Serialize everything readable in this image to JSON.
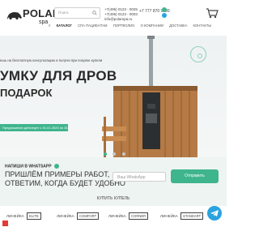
{
  "brand": {
    "name": "POLAR",
    "sub": "spa"
  },
  "search": {
    "placeholder": "Поиск"
  },
  "contacts": {
    "phone1": "+7(495) 0123 - 0025",
    "phone1_line2": "+7(495) 0123 - 0003",
    "email": "info@polarspa.ru",
    "phone2": "+7 777 870 9899"
  },
  "nav": {
    "items": [
      "КАТАЛОГ",
      "СПА ПАЦИЕНТАМ",
      "ПОРТФОЛИО",
      "О КОМПАНИИ",
      "ДОСТАВКА",
      "КОНТАКТЫ"
    ]
  },
  "hero": {
    "text1": "ешь на бесплатную консультацию и получи при покупке купели",
    "title": "УМКУ ДЛЯ ДРОВ",
    "subtitle": "ПОДАРОК",
    "badge": "Предложение действует с 01.01.2023 по 31.12.2023"
  },
  "whatsapp": {
    "heading": "НАПИШИ В WHATSAPP",
    "line1": "ПРИШЛЁМ ПРИМЕРЫ РАБОТ,",
    "line2": "ОТВЕТИМ, КОГДА БУДЕТ УДОБНО",
    "input_placeholder": "Ваш WhatsApp",
    "button": "Отправить"
  },
  "products": {
    "title": "КУПИТЬ КУПЕЛЬ",
    "tabs": [
      {
        "label": "ЛИНЕЙКА",
        "tag": "ELITE"
      },
      {
        "label": "ЛИНЕЙКА",
        "tag": "COMFORT"
      },
      {
        "label": "ЛИНЕЙКА",
        "tag": "CORNER"
      },
      {
        "label": "ЛИНЕЙКА",
        "tag": "STANDART"
      }
    ]
  },
  "colors": {
    "accent": "#3fb58d",
    "telegram": "#2aa3df"
  }
}
